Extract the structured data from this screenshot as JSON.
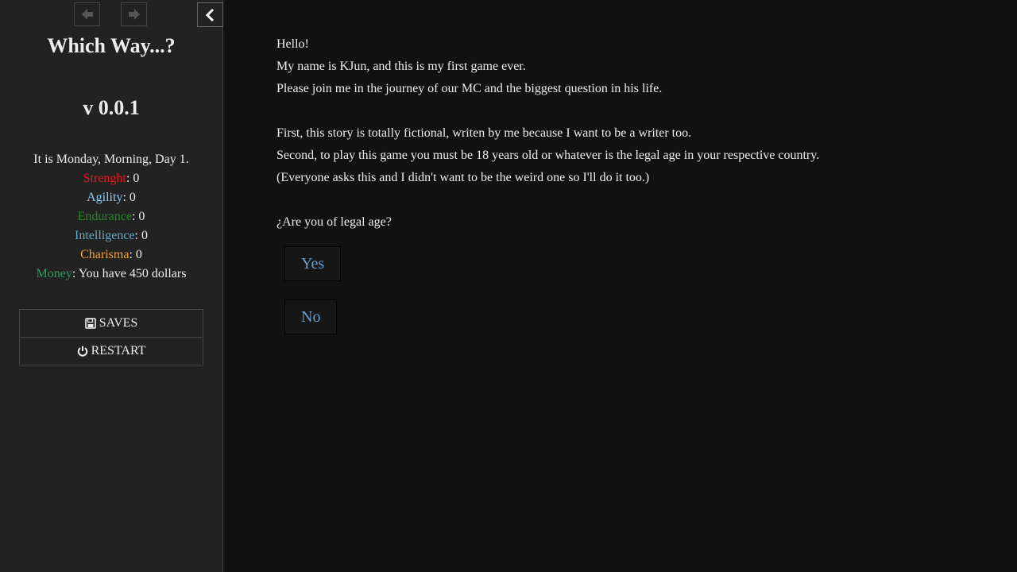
{
  "sidebar": {
    "title": "Which Way...?",
    "version": "v 0.0.1",
    "date_line": "It is Monday, Morning, Day 1.",
    "stats": [
      {
        "name": "Strenght",
        "value": ": 0",
        "color": "#e02020"
      },
      {
        "name": "Agility",
        "value": ": 0",
        "color": "#87cefa"
      },
      {
        "name": "Endurance",
        "value": ": 0",
        "color": "#1e8c1e"
      },
      {
        "name": "Intelligence",
        "value": ": 0",
        "color": "#5fa8c8"
      },
      {
        "name": "Charisma",
        "value": ": 0",
        "color": "#f4a030"
      },
      {
        "name": "Money",
        "value": ": You have 450 dollars",
        "color": "#20a060"
      }
    ],
    "menu": {
      "saves_label": "SAVES",
      "restart_label": "RESTART"
    },
    "icons": {
      "back": "arrow-left-icon",
      "forward": "arrow-right-icon",
      "toggle": "chevron-left-icon",
      "saves": "floppy-disk-icon",
      "restart": "power-icon"
    }
  },
  "passage": {
    "lines_1": [
      "Hello!",
      "My name is KJun, and this is my first game ever.",
      "Please join me in the journey of our MC and the biggest question in his life."
    ],
    "lines_2": [
      "First, this story is totally fictional, writen by me because I want to be a writer too.",
      "Second, to play this game you must be 18 years old or whatever is the legal age in your respective country.",
      "(Everyone asks this and I didn't want to be the weird one so I'll do it too.)"
    ],
    "question": "¿Are you of legal age?",
    "choices": {
      "yes": "Yes",
      "no": "No"
    }
  },
  "colors": {
    "background": "#111111",
    "sidebar": "#222222",
    "link": "#68a0cf"
  }
}
